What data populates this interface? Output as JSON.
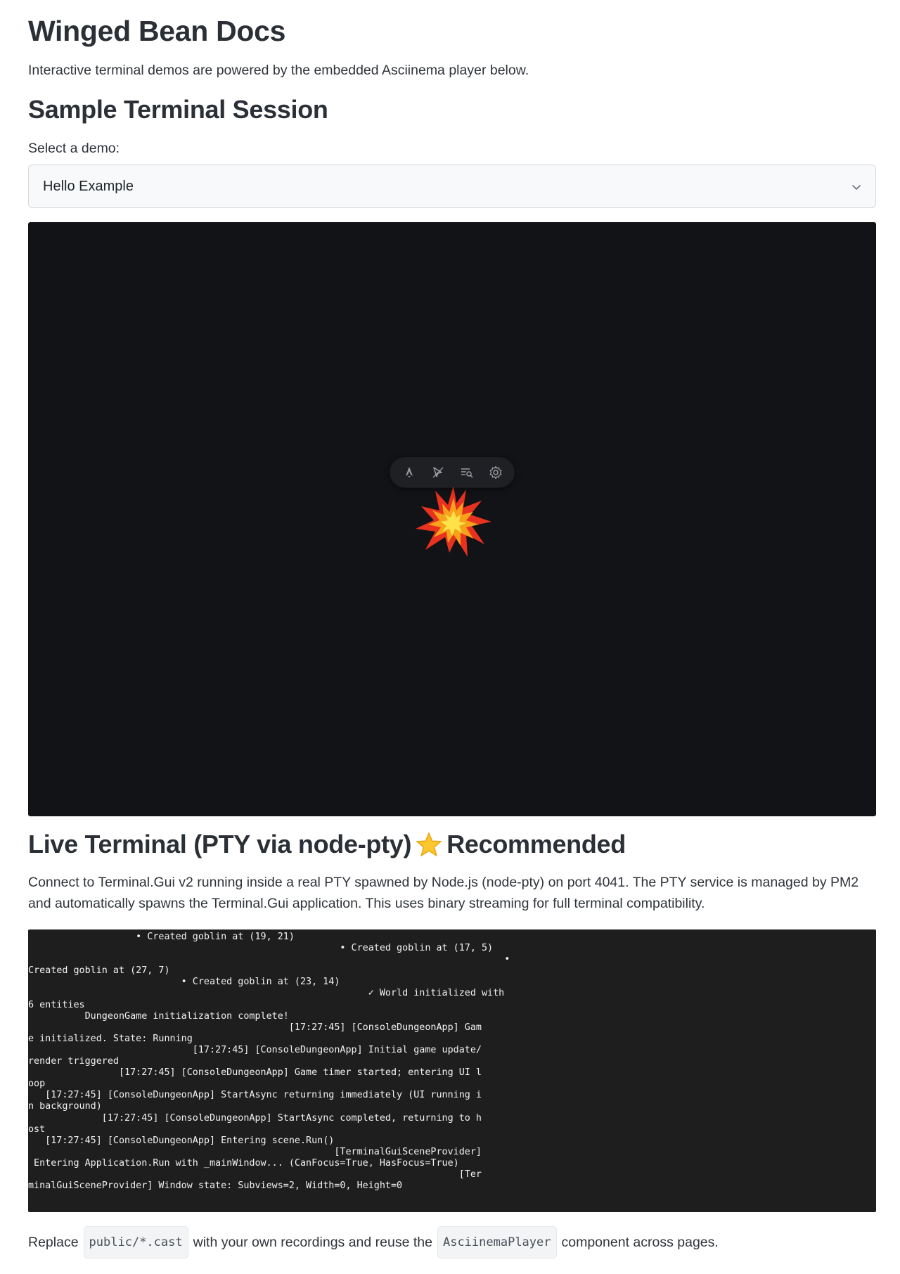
{
  "page": {
    "title": "Winged Bean Docs",
    "intro": "Interactive terminal demos are powered by the embedded Asciinema player below."
  },
  "sample_section": {
    "heading": "Sample Terminal Session",
    "select_label": "Select a demo:",
    "selected_demo": "Hello Example"
  },
  "player": {
    "toolbar_icons": [
      "astro-logo-icon",
      "cursor-icon",
      "search-list-icon",
      "gear-icon"
    ],
    "decoration": "explosion-burst"
  },
  "live_section": {
    "heading_prefix": "Live Terminal (PTY via node-pty)",
    "heading_suffix": "Recommended",
    "description": "Connect to Terminal.Gui v2 running inside a real PTY spawned by Node.js (node-pty) on port 4041. The PTY service is managed by PM2 and automatically spawns the Terminal.Gui application. This uses binary streaming for full terminal compatibility."
  },
  "terminal": {
    "lines": [
      "                   • Created goblin at (19, 21)",
      "                                                       • Created goblin at (17, 5)",
      "                                                                                    •",
      "Created goblin at (27, 7)",
      "                           • Created goblin at (23, 14)",
      "                                                            ✓ World initialized with",
      "6 entities",
      "          DungeonGame initialization complete!",
      "                                              [17:27:45] [ConsoleDungeonApp] Gam",
      "e initialized. State: Running",
      "                             [17:27:45] [ConsoleDungeonApp] Initial game update/",
      "render triggered",
      "                [17:27:45] [ConsoleDungeonApp] Game timer started; entering UI l",
      "oop",
      "   [17:27:45] [ConsoleDungeonApp] StartAsync returning immediately (UI running i",
      "n background)",
      "             [17:27:45] [ConsoleDungeonApp] StartAsync completed, returning to h",
      "ost",
      "   [17:27:45] [ConsoleDungeonApp] Entering scene.Run()",
      "                                                      [TerminalGuiSceneProvider]",
      " Entering Application.Run with _mainWindow... (CanFocus=True, HasFocus=True)",
      "                                                                            [Ter",
      "minalGuiSceneProvider] Window state: Subviews=2, Width=0, Height=0"
    ]
  },
  "footer": {
    "before": "Replace",
    "code1": "public/*.cast",
    "middle": "with your own recordings and reuse the",
    "code2": "AsciinemaPlayer",
    "after": "component across pages."
  },
  "colors": {
    "player_bg": "#121316",
    "terminal_bg": "#1e1e1e",
    "heading": "#2b2f36",
    "text": "#2f343b"
  }
}
